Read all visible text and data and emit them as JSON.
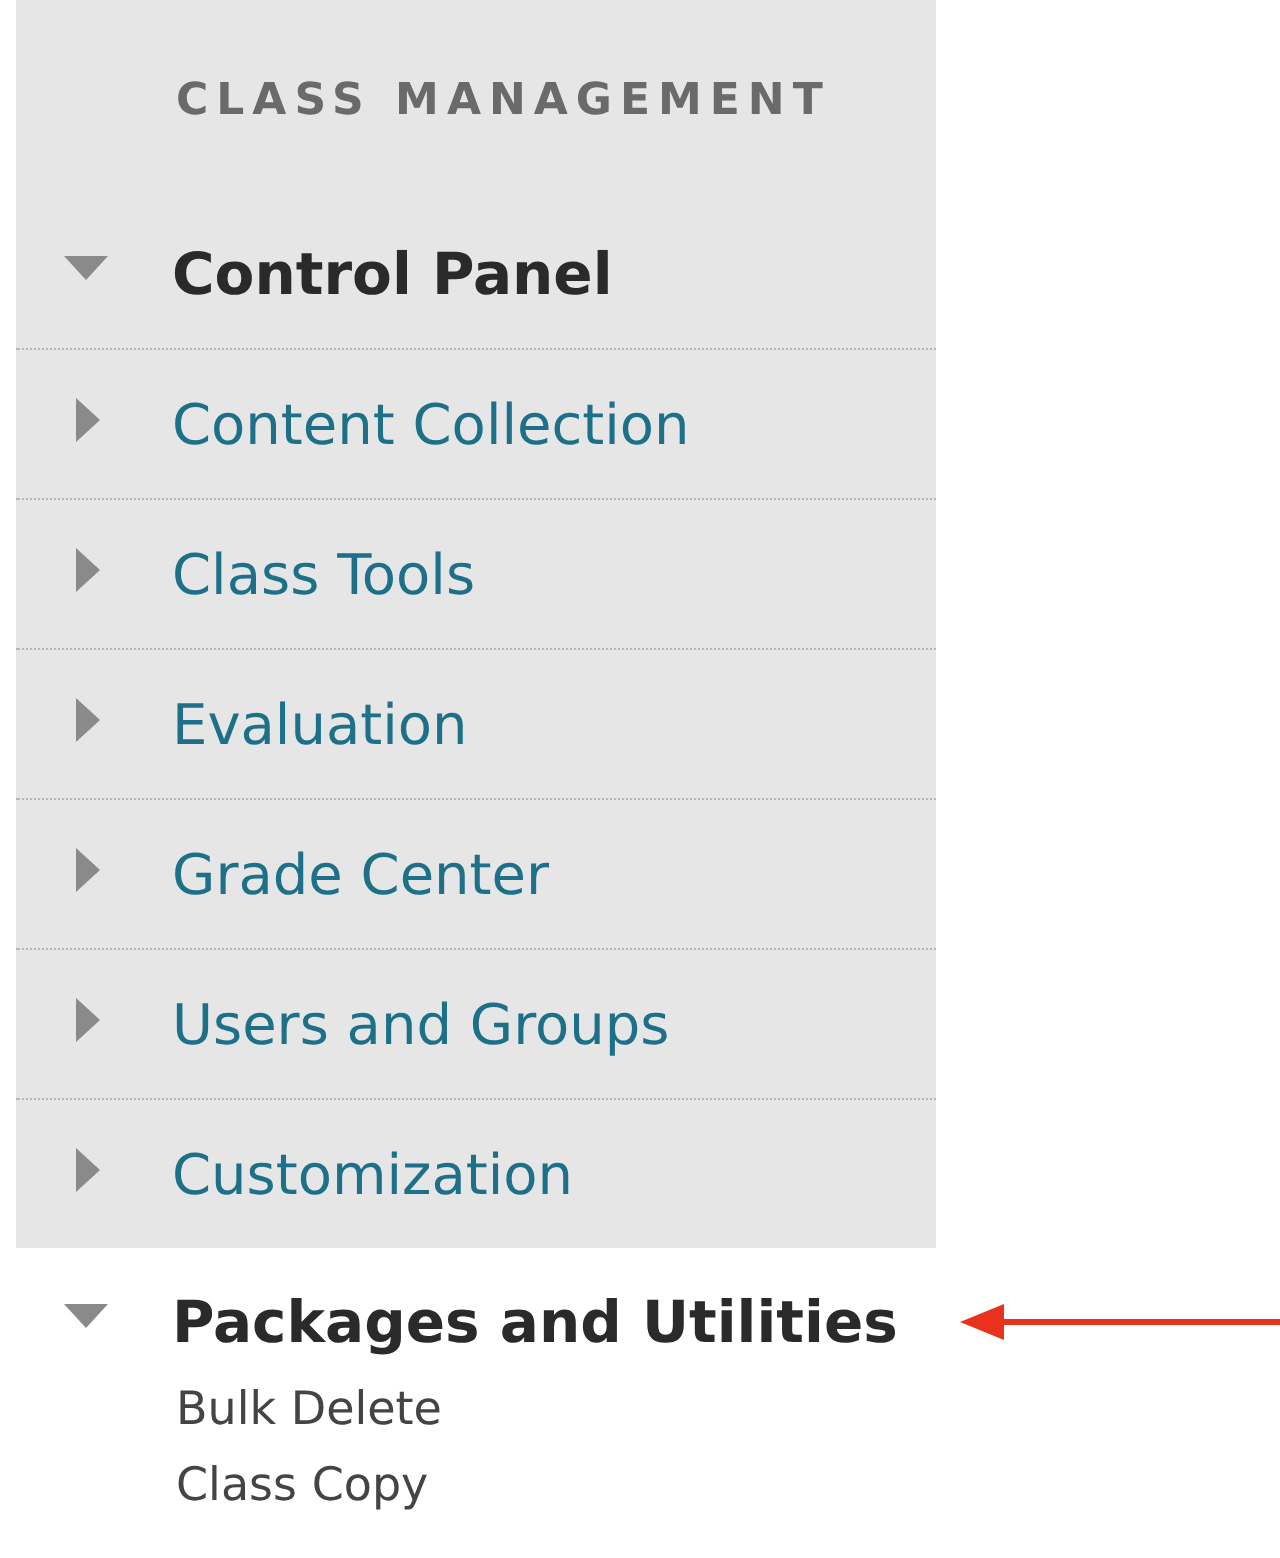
{
  "sidebar": {
    "heading": "CLASS MANAGEMENT",
    "items": [
      {
        "label": "Control Panel",
        "expanded": true,
        "shaded": true,
        "pointed": false,
        "children": [
          {
            "label": "Content Collection",
            "expanded": false
          },
          {
            "label": "Class Tools",
            "expanded": false
          },
          {
            "label": "Evaluation",
            "expanded": false
          },
          {
            "label": "Grade Center",
            "expanded": false
          },
          {
            "label": "Users and Groups",
            "expanded": false
          },
          {
            "label": "Customization",
            "expanded": false
          }
        ]
      },
      {
        "label": "Packages and Utilities",
        "expanded": true,
        "shaded": false,
        "pointed": true,
        "links": [
          "Bulk Delete",
          "Class Copy"
        ]
      }
    ]
  }
}
